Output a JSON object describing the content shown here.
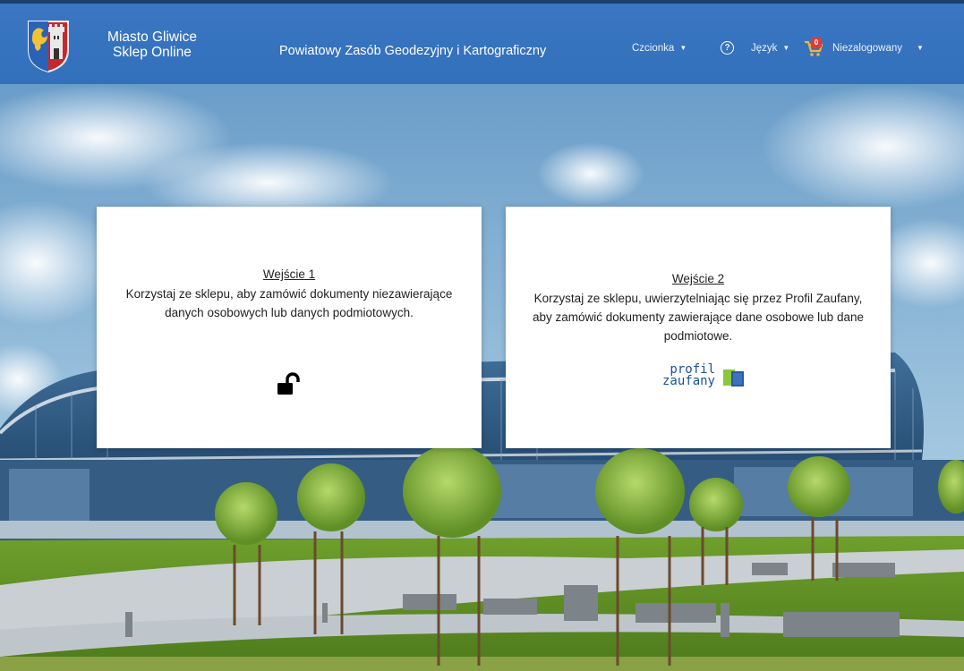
{
  "header": {
    "brand_line1": "Miasto Gliwice",
    "brand_line2": "Sklep Online",
    "title": "Powiatowy Zasób Geodezyjny i Kartograficzny",
    "font_label": "Czcionka",
    "language_label": "Język",
    "cart_count": "0",
    "user_label": "Niezalogowany",
    "bar_color": "#3572be"
  },
  "entries": [
    {
      "title": "Wejście 1",
      "text": "Korzystaj ze sklepu, aby zamówić dokumenty niezawierające danych osobowych lub danych podmiotowych.",
      "icon": "unlocked-padlock-icon"
    },
    {
      "title": "Wejście 2",
      "text": "Korzystaj ze sklepu, uwierzytelniając się przez Profil Zaufany, aby zamówić dokumenty zawierające dane osobowe lub dane podmiotowe.",
      "logo_line1": "profil",
      "logo_line2": "zaufany"
    }
  ]
}
